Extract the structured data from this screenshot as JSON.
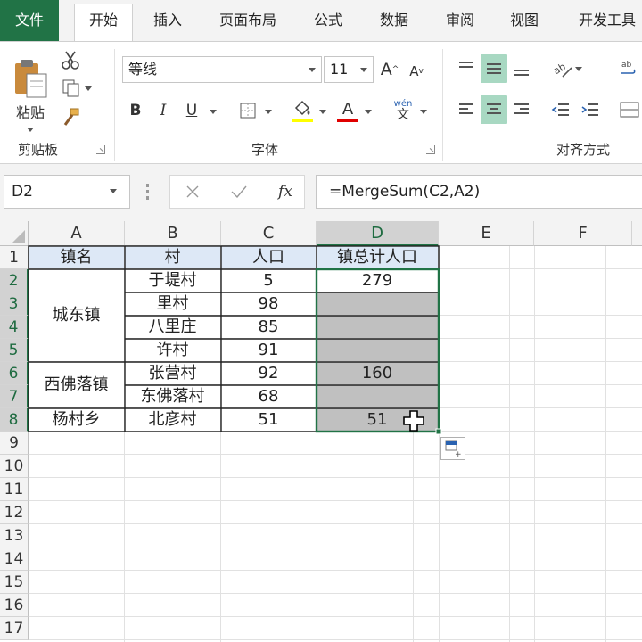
{
  "ribbon_tabs": [
    "文件",
    "开始",
    "插入",
    "页面布局",
    "公式",
    "数据",
    "审阅",
    "视图",
    "开发工具"
  ],
  "clipboard": {
    "paste_label": "粘贴",
    "group_label": "剪贴板"
  },
  "font": {
    "name": "等线",
    "size": "11",
    "group_label": "字体",
    "bold": "B",
    "italic": "I",
    "underline": "U",
    "grow": "A",
    "shrink": "A",
    "font_color": "A",
    "phonetic_top": "wén",
    "phonetic_bottom": "文"
  },
  "alignment": {
    "group_label": "对齐方式"
  },
  "formula_bar": {
    "name_box": "D2",
    "formula": "=MergeSum(C2,A2)",
    "fx": "fx"
  },
  "columns": [
    "A",
    "B",
    "C",
    "D",
    "E",
    "F"
  ],
  "rows": [
    "1",
    "2",
    "3",
    "4",
    "5",
    "6",
    "7",
    "8",
    "9",
    "10",
    "11",
    "12",
    "13",
    "14",
    "15",
    "16",
    "17"
  ],
  "table": {
    "headers": [
      "镇名",
      "村",
      "人口",
      "镇总计人口"
    ],
    "towns": [
      "城东镇",
      "西佛落镇",
      "杨村乡"
    ],
    "villages": [
      "于堤村",
      "里村",
      "八里庄",
      "许村",
      "张营村",
      "东佛落村",
      "北彦村"
    ],
    "population": [
      "5",
      "98",
      "85",
      "91",
      "92",
      "68",
      "51"
    ],
    "totals": [
      "279",
      "160",
      "51"
    ]
  },
  "colors": {
    "accent": "#217346",
    "header_fill": "#dde8f6",
    "merged_fill": "#c0c0c0",
    "highlight": "#a8d8c2"
  }
}
